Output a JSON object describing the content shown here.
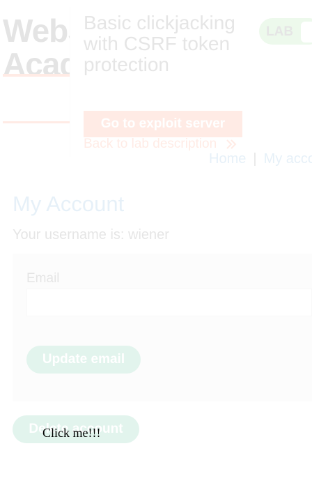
{
  "victim_frame": {
    "logo_lines": [
      "WebS",
      "Acade"
    ],
    "lab_title": "Basic clickjacking with CSRF token protection",
    "lab_badge": "LAB",
    "exploit_button": "Go to exploit server",
    "back_link": "Back to lab description",
    "back_link_icon": "chevron-double-right-icon",
    "nav": {
      "home": "Home",
      "separator": "|",
      "my_account": "My account"
    },
    "page_title": "My Account",
    "username_line": "Your username is: wiener",
    "email_label": "Email",
    "email_value": "",
    "update_button": "Update email",
    "delete_button": "Delete account",
    "colors": {
      "accent": "#ff6633",
      "primary_button": "#1aa874",
      "link": "#3b8dcb",
      "badge": "#70d16d"
    }
  },
  "decoy": {
    "text": "Click me!!!"
  }
}
